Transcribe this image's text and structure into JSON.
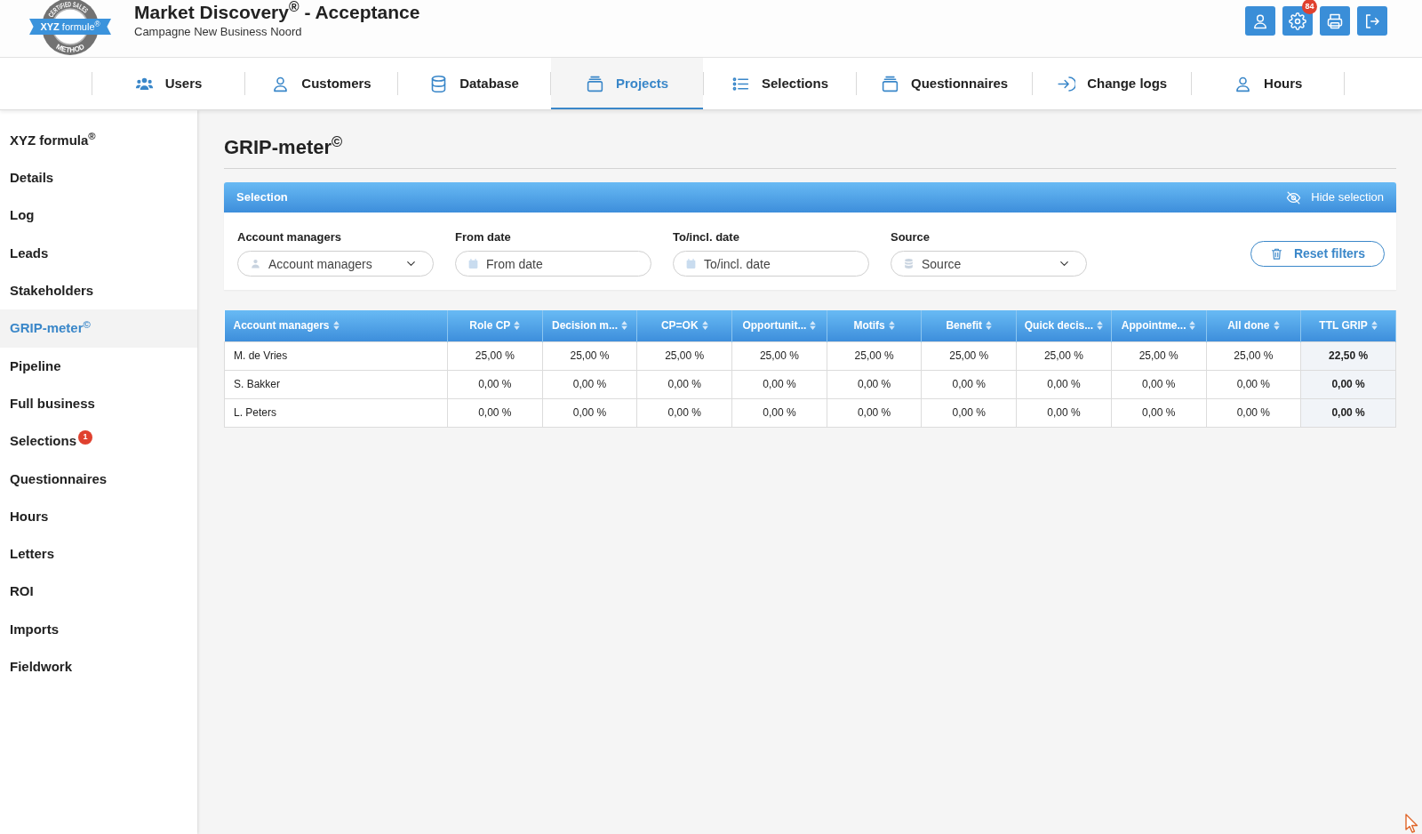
{
  "header": {
    "logo": {
      "arc_top": "CERTIFIED SALES",
      "ribbon": "**XYZ** formule$^{®}$",
      "arc_bottom": "METHOD"
    },
    "title": "Market Discovery$^{®}$ - Acceptance",
    "subtitle": "Campagne New Business Noord",
    "settings_badge": "84"
  },
  "nav_tabs": [
    {
      "label": "Users",
      "selected": false
    },
    {
      "label": "Customers",
      "selected": false
    },
    {
      "label": "Database",
      "selected": false
    },
    {
      "label": "Projects",
      "selected": true
    },
    {
      "label": "Selections",
      "selected": false
    },
    {
      "label": "Questionnaires",
      "selected": false
    },
    {
      "label": "Change logs",
      "selected": false
    },
    {
      "label": "Hours",
      "selected": false
    }
  ],
  "sidebar": {
    "items": [
      {
        "label": "XYZ formula$^{®}$",
        "selected": false
      },
      {
        "label": "Details",
        "selected": false
      },
      {
        "label": "Log",
        "selected": false
      },
      {
        "label": "Leads",
        "selected": false
      },
      {
        "label": "Stakeholders",
        "selected": false
      },
      {
        "label": "GRIP-meter$^{©}$",
        "selected": true
      },
      {
        "label": "Pipeline",
        "selected": false
      },
      {
        "label": "Full business",
        "selected": false
      },
      {
        "label": "Selections",
        "selected": false,
        "badge": "1"
      },
      {
        "label": "Questionnaires",
        "selected": false
      },
      {
        "label": "Hours",
        "selected": false
      },
      {
        "label": "Letters",
        "selected": false
      },
      {
        "label": "ROI",
        "selected": false
      },
      {
        "label": "Imports",
        "selected": false
      },
      {
        "label": "Fieldwork",
        "selected": false
      }
    ]
  },
  "main": {
    "title": "GRIP-meter$^{©}$",
    "selection": {
      "title": "Selection",
      "hide_button": "Hide selection",
      "filters": [
        {
          "kind": "select",
          "label": "Account managers",
          "placeholder": "Account managers"
        },
        {
          "kind": "date",
          "label": "From date",
          "placeholder": "From date"
        },
        {
          "kind": "date",
          "label": "To/incl. date",
          "placeholder": "To/incl. date"
        },
        {
          "kind": "select",
          "label": "Source",
          "placeholder": "Source"
        }
      ],
      "reset_button": "Reset filters"
    },
    "table": {
      "columns": [
        "Account managers",
        "Role CP",
        "Decision m...",
        "CP=OK",
        "Opportunit...",
        "Motifs",
        "Benefit",
        "Quick decis...",
        "Appointme...",
        "All done",
        "TTL GRIP"
      ],
      "rows": [
        {
          "cells": [
            "M. de Vries",
            "25,00 %",
            "25,00 %",
            "25,00 %",
            "25,00 %",
            "25,00 %",
            "25,00 %",
            "25,00 %",
            "25,00 %",
            "25,00 %",
            "22,50 %"
          ]
        },
        {
          "cells": [
            "S. Bakker",
            "0,00 %",
            "0,00 %",
            "0,00 %",
            "0,00 %",
            "0,00 %",
            "0,00 %",
            "0,00 %",
            "0,00 %",
            "0,00 %",
            "0,00 %"
          ]
        },
        {
          "cells": [
            "L. Peters",
            "0,00 %",
            "0,00 %",
            "0,00 %",
            "0,00 %",
            "0,00 %",
            "0,00 %",
            "0,00 %",
            "0,00 %",
            "0,00 %",
            "0,00 %"
          ]
        }
      ]
    }
  }
}
